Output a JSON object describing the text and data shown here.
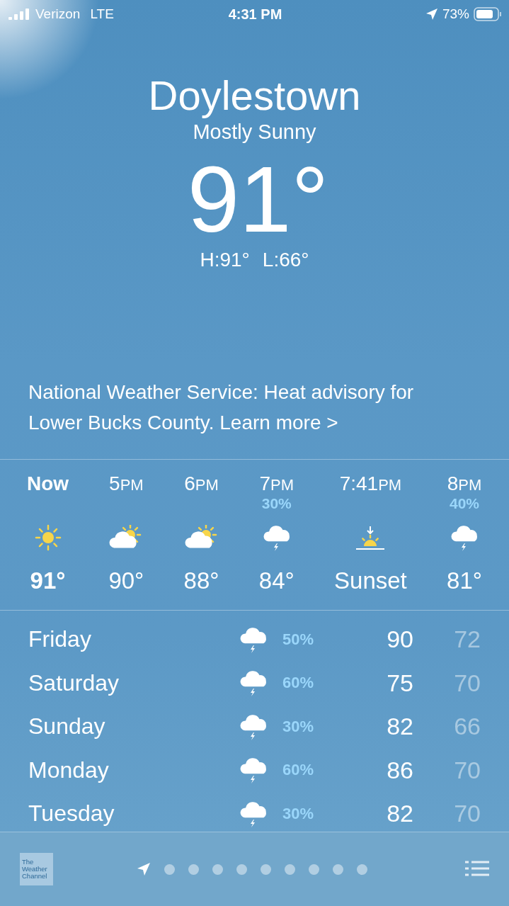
{
  "status_bar": {
    "carrier": "Verizon",
    "network": "LTE",
    "time": "4:31 PM",
    "battery": "73%"
  },
  "header": {
    "city": "Doylestown",
    "condition": "Mostly Sunny",
    "temperature": "91°",
    "high": "H:91°",
    "low": "L:66°"
  },
  "advisory": {
    "text": "National Weather Service: Heat advisory for Lower Bucks County.",
    "link": "Learn more",
    "chevron": ">"
  },
  "hourly": [
    {
      "time": "Now",
      "selected": true,
      "kind": "sun",
      "value": "91°"
    },
    {
      "time": "5",
      "suffix": "PM",
      "selected": false,
      "kind": "partly",
      "value": "90°"
    },
    {
      "time": "6",
      "suffix": "PM",
      "selected": false,
      "kind": "partly",
      "value": "88°"
    },
    {
      "time": "7",
      "suffix": "PM",
      "selected": false,
      "precip": "30%",
      "kind": "storm",
      "value": "84°"
    },
    {
      "time": "7:41",
      "suffix": "PM",
      "selected": false,
      "kind": "sunset",
      "value": "Sunset"
    },
    {
      "time": "8",
      "suffix": "PM",
      "selected": false,
      "precip": "40%",
      "kind": "storm",
      "value": "81°"
    }
  ],
  "daily": [
    {
      "day": "Friday",
      "kind": "storm",
      "precip": "50%",
      "high": "90",
      "low": "72"
    },
    {
      "day": "Saturday",
      "kind": "storm",
      "precip": "60%",
      "high": "75",
      "low": "70"
    },
    {
      "day": "Sunday",
      "kind": "storm",
      "precip": "30%",
      "high": "82",
      "low": "66"
    },
    {
      "day": "Monday",
      "kind": "storm",
      "precip": "60%",
      "high": "86",
      "low": "70"
    },
    {
      "day": "Tuesday",
      "kind": "storm",
      "precip": "30%",
      "high": "82",
      "low": "70"
    }
  ],
  "footer": {
    "logo": [
      "The",
      "Weather",
      "Channel"
    ],
    "pages": [
      {
        "kind": "location",
        "selected": true
      },
      {
        "kind": "dot",
        "selected": false
      },
      {
        "kind": "dot",
        "selected": false
      },
      {
        "kind": "dot",
        "selected": false
      },
      {
        "kind": "dot",
        "selected": false
      },
      {
        "kind": "dot",
        "selected": false
      },
      {
        "kind": "dot",
        "selected": false
      },
      {
        "kind": "dot",
        "selected": false
      },
      {
        "kind": "dot",
        "selected": false
      },
      {
        "kind": "dot",
        "selected": false
      }
    ]
  }
}
